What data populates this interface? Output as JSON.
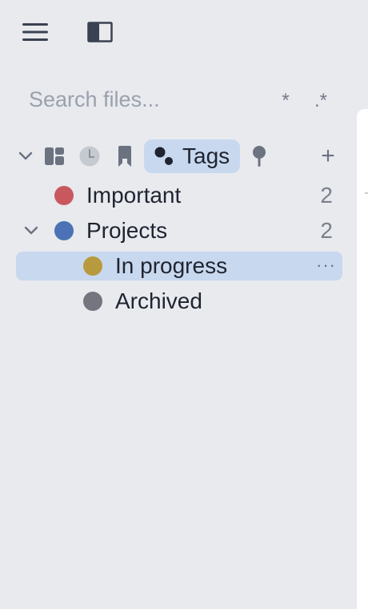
{
  "toolbar": {
    "menu_icon": "hamburger-menu-icon",
    "sidebar_icon": "sidebar-layout-icon"
  },
  "search": {
    "placeholder": "Search files...",
    "value": "",
    "glob_toggle": "*",
    "regex_toggle": ".*"
  },
  "views": {
    "collapse_icon": "chevron-down-icon",
    "tabs": [
      {
        "icon": "file-explorer-icon",
        "label": ""
      },
      {
        "icon": "clock-icon",
        "label": ""
      },
      {
        "icon": "bookmark-icon",
        "label": ""
      },
      {
        "icon": "tags-icon",
        "label": "Tags",
        "active": true
      },
      {
        "icon": "pin-icon",
        "label": ""
      }
    ],
    "add_label": "+"
  },
  "tags": {
    "items": [
      {
        "name": "Important",
        "count": "2",
        "color": "#c9585e",
        "expanded": null,
        "level": 0
      },
      {
        "name": "Projects",
        "count": "2",
        "color": "#4a72b5",
        "expanded": true,
        "level": 0
      },
      {
        "name": "In progress",
        "count": "",
        "color": "#b89a3e",
        "level": 1,
        "selected": true,
        "more": "···"
      },
      {
        "name": "Archived",
        "count": "",
        "color": "#74757f",
        "level": 1
      }
    ]
  },
  "colors": {
    "background": "#e8eaee",
    "selection": "#c8d8ee",
    "text": "#1f2430",
    "muted": "#9aa1ad"
  }
}
